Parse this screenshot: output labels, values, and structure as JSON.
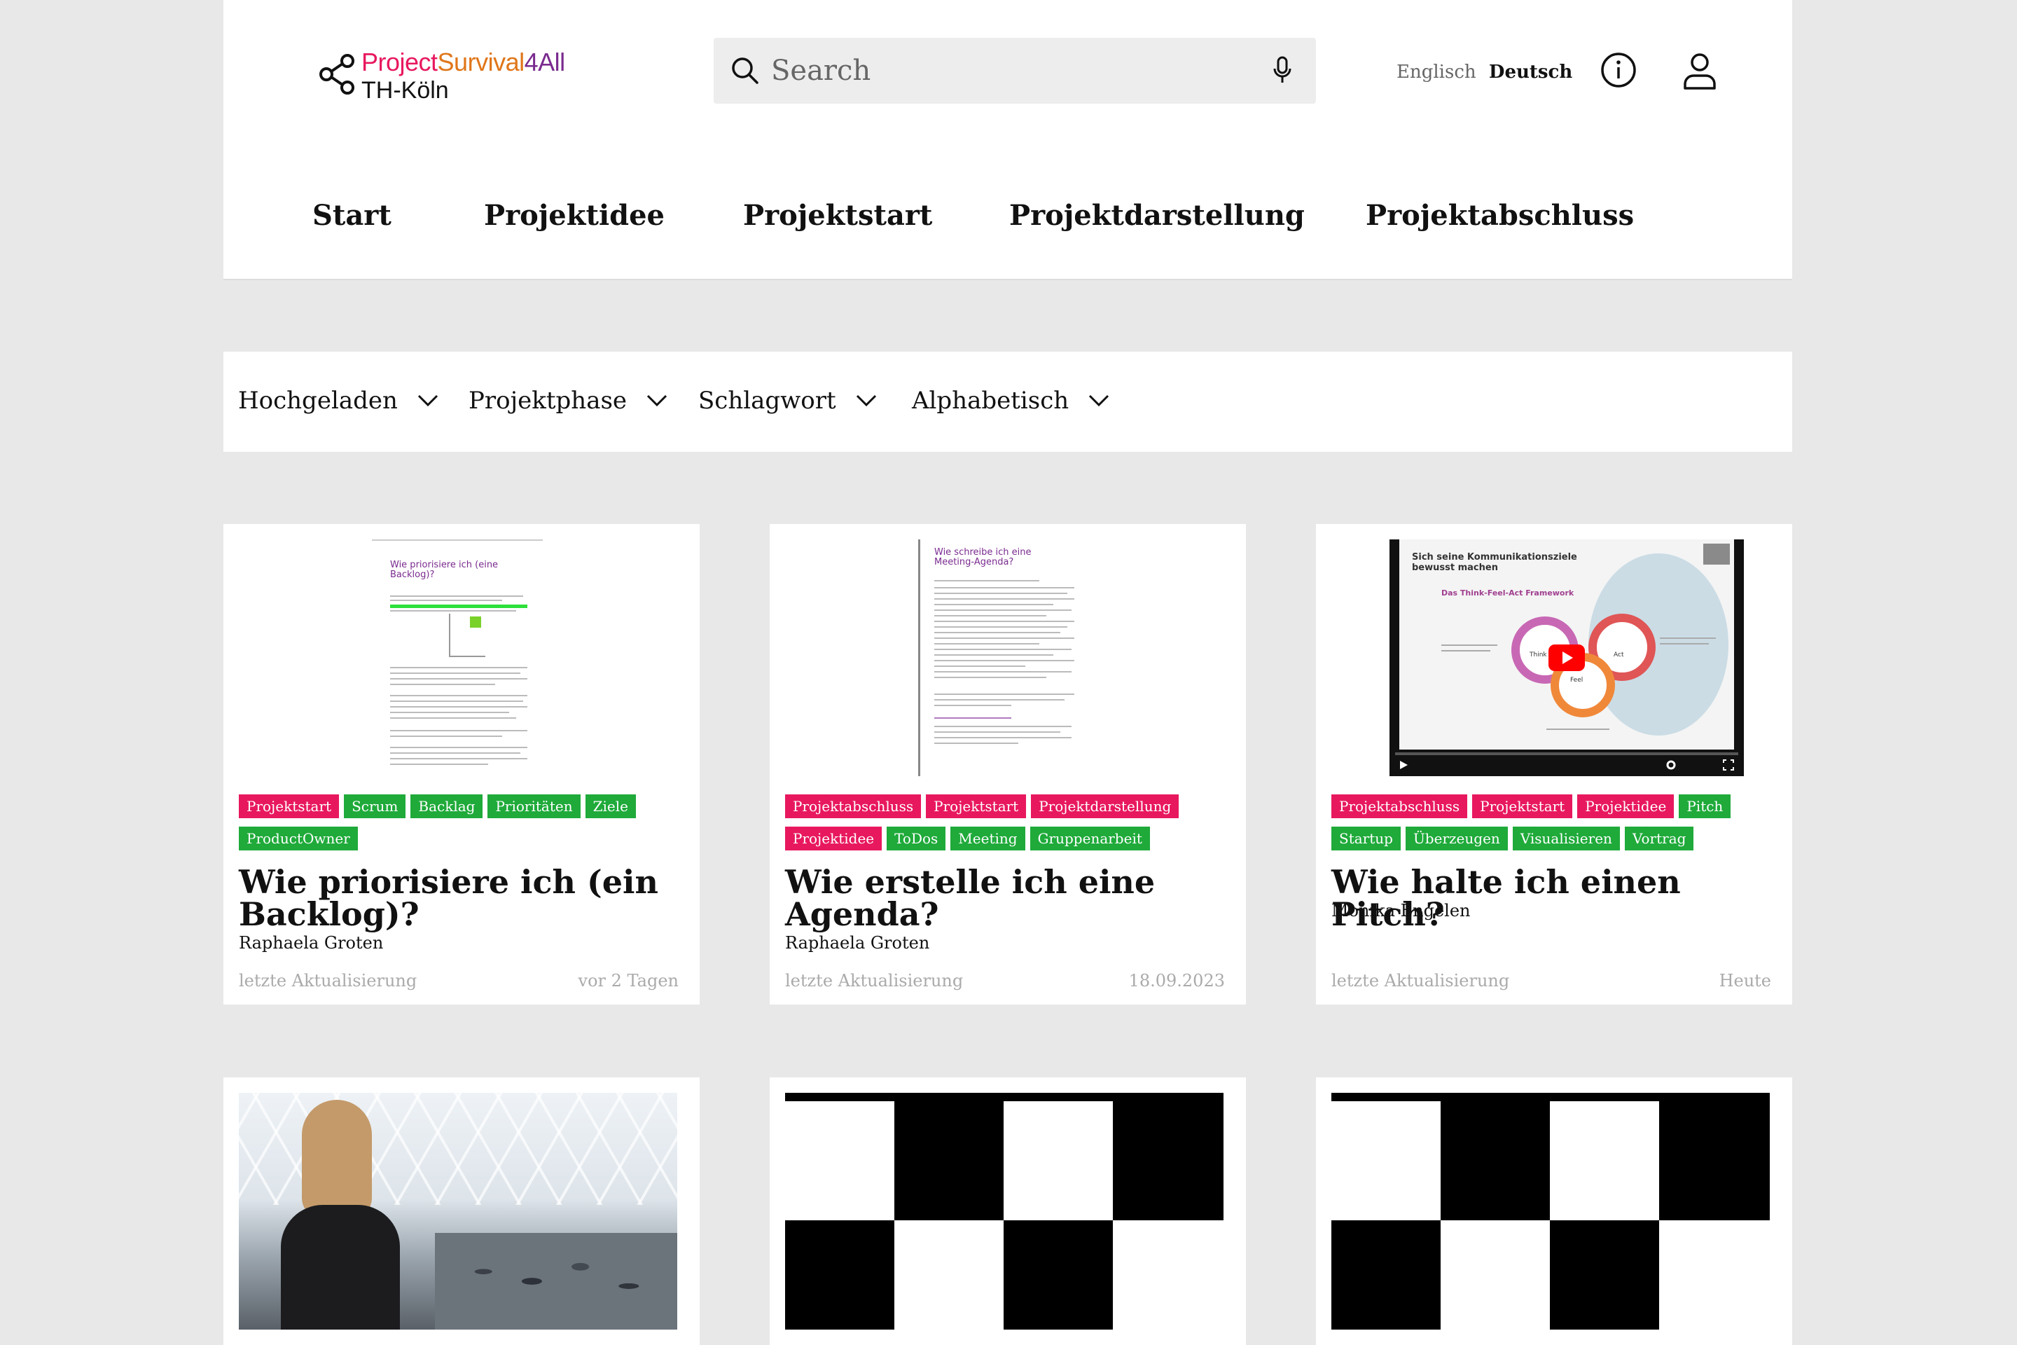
{
  "brand": {
    "part1": "Project",
    "part2": "Survival",
    "part3": "4All",
    "sub": "TH-Köln",
    "colors": {
      "project": "#e8185f",
      "survival": "#e38a1b",
      "four": "#1faa3a",
      "all": "#7a2b8f"
    }
  },
  "search": {
    "placeholder": "Search"
  },
  "language": {
    "english": "Englisch",
    "german": "Deutsch"
  },
  "nav": [
    "Start",
    "Projektidee",
    "Projektstart",
    "Projektdarstellung",
    "Projektabschluss"
  ],
  "filters": [
    "Hochgeladen",
    "Projektphase",
    "Schlagwort",
    "Alphabetisch"
  ],
  "cards": [
    {
      "tags": [
        {
          "label": "Projektstart",
          "color": "pink"
        },
        {
          "label": "Scrum",
          "color": "green"
        },
        {
          "label": "Backlag",
          "color": "green"
        },
        {
          "label": "Prioritäten",
          "color": "green"
        },
        {
          "label": "Ziele",
          "color": "green"
        },
        {
          "label": "ProductOwner",
          "color": "green"
        }
      ],
      "title": "Wie priorisiere ich (ein Backlog)?",
      "author": "Raphaela Groten",
      "updated_label": "letzte Aktualisierung",
      "updated": "vor 2 Tagen",
      "thumb_heading": "Wie priorisiere ich (eine Backlog)?"
    },
    {
      "tags": [
        {
          "label": "Projektabschluss",
          "color": "pink"
        },
        {
          "label": "Projektstart",
          "color": "pink"
        },
        {
          "label": "Projektdarstellung",
          "color": "pink"
        },
        {
          "label": "Projektidee",
          "color": "pink"
        },
        {
          "label": "ToDos",
          "color": "green"
        },
        {
          "label": "Meeting",
          "color": "green"
        },
        {
          "label": "Gruppenarbeit",
          "color": "green"
        }
      ],
      "title": "Wie erstelle ich eine Agenda?",
      "author": "Raphaela Groten",
      "updated_label": "letzte Aktualisierung",
      "updated": "18.09.2023",
      "thumb_heading": "Wie schreibe ich eine Meeting-Agenda?"
    },
    {
      "tags": [
        {
          "label": "Projektabschluss",
          "color": "pink"
        },
        {
          "label": "Projektstart",
          "color": "pink"
        },
        {
          "label": "Projektidee",
          "color": "pink"
        },
        {
          "label": "Pitch",
          "color": "green"
        },
        {
          "label": "Startup",
          "color": "green"
        },
        {
          "label": "Überzeugen",
          "color": "green"
        },
        {
          "label": "Visualisieren",
          "color": "green"
        },
        {
          "label": "Vortrag",
          "color": "green"
        }
      ],
      "title": "Wie halte ich einen Pitch?",
      "author": "Monika Engelen",
      "updated_label": "letzte Aktualisierung",
      "updated": "Heute",
      "video": {
        "slide_title": "Sich seine Kommunikationsziele bewusst machen",
        "framework": "Das Think-Feel-Act Framework",
        "think": "Think",
        "feel": "Feel",
        "act": "Act"
      }
    }
  ]
}
